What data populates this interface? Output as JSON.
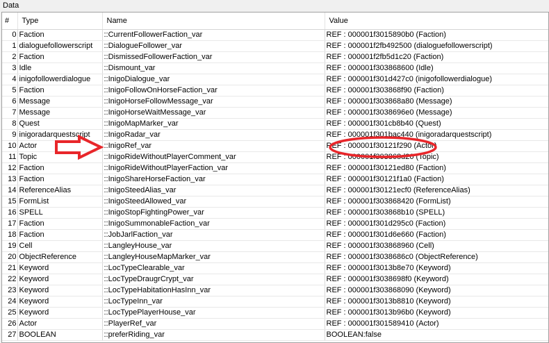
{
  "panel_title": "Data",
  "columns": {
    "num": "#",
    "type": "Type",
    "name": "Name",
    "value": "Value"
  },
  "rows": [
    {
      "num": "0",
      "type": "Faction",
      "name": "::CurrentFollowerFaction_var",
      "value": "REF : 000001f3015890b0 (Faction)"
    },
    {
      "num": "1",
      "type": "dialoguefollowerscript",
      "name": "::DialogueFollower_var",
      "value": "REF : 000001f2fb492500 (dialoguefollowerscript)"
    },
    {
      "num": "2",
      "type": "Faction",
      "name": "::DismissedFollowerFaction_var",
      "value": "REF : 000001f2fb5d1c20 (Faction)"
    },
    {
      "num": "3",
      "type": "Idle",
      "name": "::Dismount_var",
      "value": "REF : 000001f303868600 (Idle)"
    },
    {
      "num": "4",
      "type": "inigofollowerdialogue",
      "name": "::InigoDialogue_var",
      "value": "REF : 000001f301d427c0 (inigofollowerdialogue)"
    },
    {
      "num": "5",
      "type": "Faction",
      "name": "::InigoFollowOnHorseFaction_var",
      "value": "REF : 000001f303868f90 (Faction)"
    },
    {
      "num": "6",
      "type": "Message",
      "name": "::InigoHorseFollowMessage_var",
      "value": "REF : 000001f303868a80 (Message)"
    },
    {
      "num": "7",
      "type": "Message",
      "name": "::InigoHorseWaitMessage_var",
      "value": "REF : 000001f3038696e0 (Message)"
    },
    {
      "num": "8",
      "type": "Quest",
      "name": "::InigoMapMarker_var",
      "value": "REF : 000001f301cb8b40 (Quest)"
    },
    {
      "num": "9",
      "type": "inigoradarquestscript",
      "name": "::InigoRadar_var",
      "value": "REF : 000001f301bac440 (inigoradarquestscript)"
    },
    {
      "num": "10",
      "type": "Actor",
      "name": "::InigoRef_var",
      "value": "REF : 000001f30121f290 (Actor)"
    },
    {
      "num": "11",
      "type": "Topic",
      "name": "::InigoRideWithoutPlayerComment_var",
      "value": "REF : 000001f303868d20 (Topic)"
    },
    {
      "num": "12",
      "type": "Faction",
      "name": "::InigoRideWithoutPlayerFaction_var",
      "value": "REF : 000001f30121ed80 (Faction)"
    },
    {
      "num": "13",
      "type": "Faction",
      "name": "::InigoShareHorseFaction_var",
      "value": "REF : 000001f30121f1a0 (Faction)"
    },
    {
      "num": "14",
      "type": "ReferenceAlias",
      "name": "::InigoSteedAlias_var",
      "value": "REF : 000001f30121ecf0 (ReferenceAlias)"
    },
    {
      "num": "15",
      "type": "FormList",
      "name": "::InigoSteedAllowed_var",
      "value": "REF : 000001f303868420 (FormList)"
    },
    {
      "num": "16",
      "type": "SPELL",
      "name": "::InigoStopFightingPower_var",
      "value": "REF : 000001f303868b10 (SPELL)"
    },
    {
      "num": "17",
      "type": "Faction",
      "name": "::InigoSummonableFaction_var",
      "value": "REF : 000001f301d295c0 (Faction)"
    },
    {
      "num": "18",
      "type": "Faction",
      "name": "::JobJarlFaction_var",
      "value": "REF : 000001f301d6e660 (Faction)"
    },
    {
      "num": "19",
      "type": "Cell",
      "name": "::LangleyHouse_var",
      "value": "REF : 000001f303868960 (Cell)"
    },
    {
      "num": "20",
      "type": "ObjectReference",
      "name": "::LangleyHouseMapMarker_var",
      "value": "REF : 000001f3038686c0 (ObjectReference)"
    },
    {
      "num": "21",
      "type": "Keyword",
      "name": "::LocTypeClearable_var",
      "value": "REF : 000001f3013b8e70 (Keyword)"
    },
    {
      "num": "22",
      "type": "Keyword",
      "name": "::LocTypeDraugrCrypt_var",
      "value": "REF : 000001f3038698f0 (Keyword)"
    },
    {
      "num": "23",
      "type": "Keyword",
      "name": "::LocTypeHabitationHasInn_var",
      "value": "REF : 000001f303868090 (Keyword)"
    },
    {
      "num": "24",
      "type": "Keyword",
      "name": "::LocTypeInn_var",
      "value": "REF : 000001f3013b8810 (Keyword)"
    },
    {
      "num": "25",
      "type": "Keyword",
      "name": "::LocTypePlayerHouse_var",
      "value": "REF : 000001f3013b96b0 (Keyword)"
    },
    {
      "num": "26",
      "type": "Actor",
      "name": "::PlayerRef_var",
      "value": "REF : 000001f301589410 (Actor)"
    },
    {
      "num": "27",
      "type": "BOOLEAN",
      "name": "::preferRiding_var",
      "value": "BOOLEAN:false"
    }
  ],
  "annotation": {
    "arrow_color": "#e8262a",
    "ellipse_color": "#e8262a"
  }
}
